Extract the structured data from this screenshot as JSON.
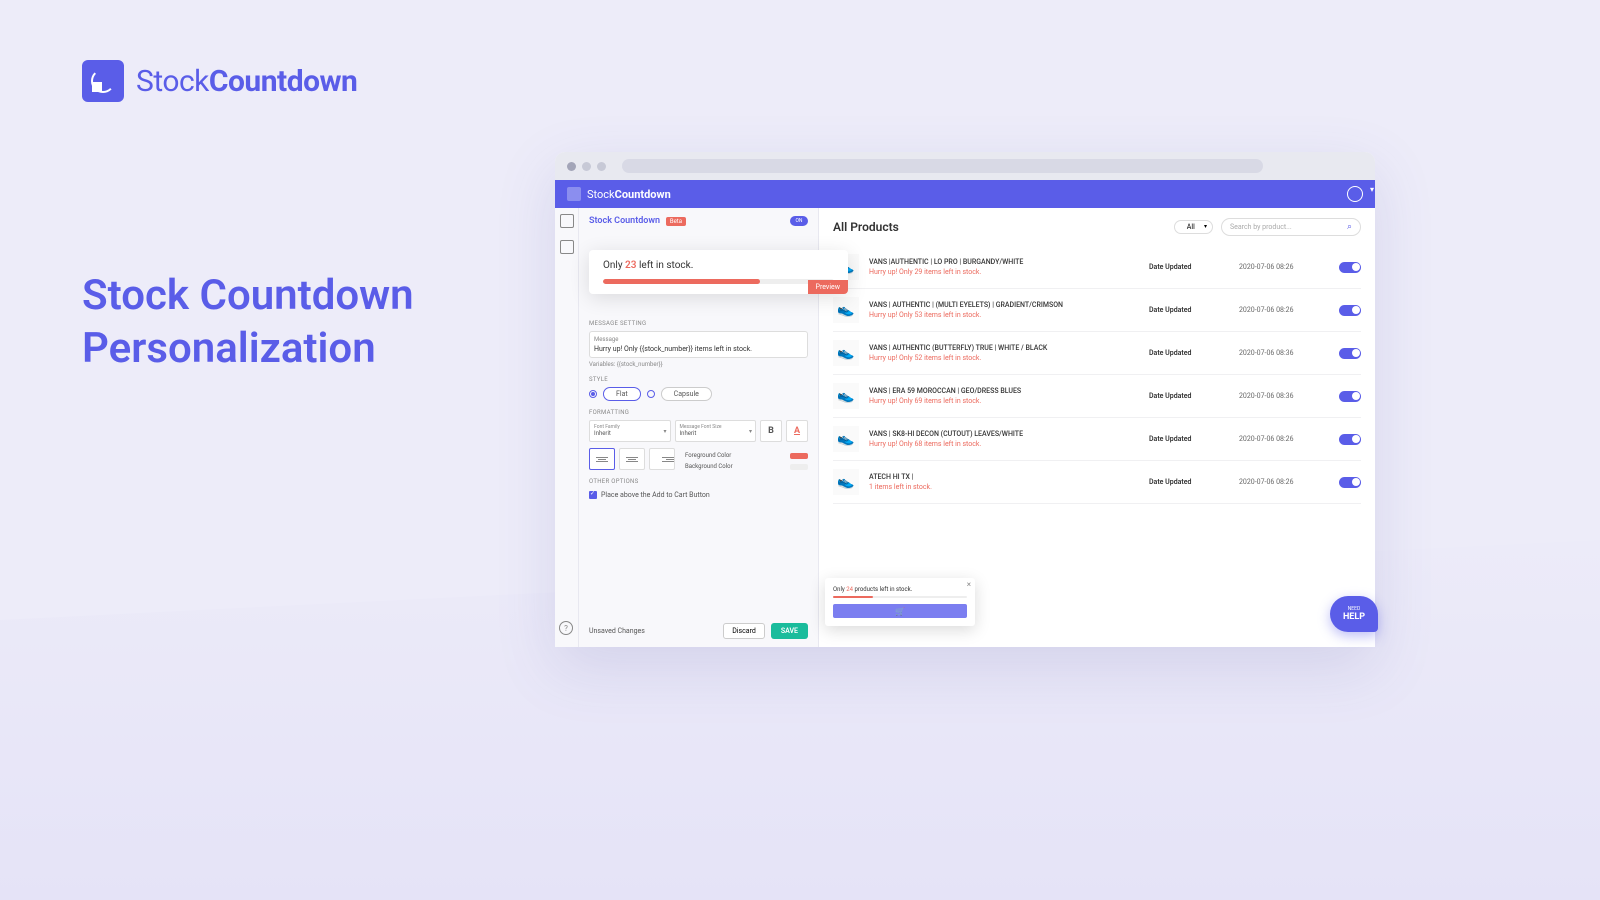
{
  "brand": {
    "name_light": "Stock",
    "name_bold": "Countdown"
  },
  "headline": {
    "line1": "Stock Countdown",
    "line2": "Personalization"
  },
  "app_header": {
    "title_light": "Stock",
    "title_bold": "Countdown"
  },
  "settings": {
    "title": "Stock Countdown",
    "beta": "Beta",
    "toggle": "ON",
    "preview": {
      "prefix": "Only ",
      "number": "23",
      "suffix": " left in stock.",
      "badge": "Preview"
    },
    "message_section": "MESSAGE SETTING",
    "message_label": "Message",
    "message_value": "Hurry up! Only {{stock_number}} items left in stock.",
    "variables_hint": "Variables: {{stock_number}}",
    "style_section": "STYLE",
    "style_flat": "Flat",
    "style_capsule": "Capsule",
    "formatting_section": "FORMATTING",
    "font_family_label": "Font Family",
    "font_family_value": "Inherit",
    "font_size_label": "Message Font Size",
    "font_size_value": "Inherit",
    "fg_color": "Foreground Color",
    "bg_color": "Background Color",
    "other_section": "OTHER OPTIONS",
    "placement": "Place above the Add to Cart Button",
    "unsaved": "Unsaved Changes",
    "discard": "Discard",
    "save": "SAVE"
  },
  "products": {
    "title": "All Products",
    "filter": "All",
    "search_placeholder": "Search by product...",
    "rows": [
      {
        "name": "VANS |AUTHENTIC | LO PRO | BURGANDY/WHITE",
        "stock": "Hurry up! Only 29 items left in stock.",
        "meta": "Date Updated",
        "date": "2020-07-06 08:26"
      },
      {
        "name": "VANS | AUTHENTIC | (MULTI EYELETS) | GRADIENT/CRIMSON",
        "stock": "Hurry up! Only 53 items left in stock.",
        "meta": "Date Updated",
        "date": "2020-07-06 08:26"
      },
      {
        "name": "VANS | AUTHENTIC (BUTTERFLY) TRUE | WHITE / BLACK",
        "stock": "Hurry up! Only 52 items left in stock.",
        "meta": "Date Updated",
        "date": "2020-07-06 08:36"
      },
      {
        "name": "VANS | ERA 59 MOROCCAN | GEO/DRESS BLUES",
        "stock": "Hurry up! Only 69 items left in stock.",
        "meta": "Date Updated",
        "date": "2020-07-06 08:36"
      },
      {
        "name": "VANS | SK8-HI DECON (CUTOUT) LEAVES/WHITE",
        "stock": "Hurry up! Only 68 items left in stock.",
        "meta": "Date Updated",
        "date": "2020-07-06 08:26"
      },
      {
        "name": "ATECH HI TX |",
        "stock": "1 items left in stock.",
        "meta": "Date Updated",
        "date": "2020-07-06 08:26"
      }
    ]
  },
  "mini": {
    "prefix": "Only ",
    "n": "24",
    "suffix": " products left in stock."
  },
  "help": {
    "need": "NEED",
    "help": "HELP"
  }
}
